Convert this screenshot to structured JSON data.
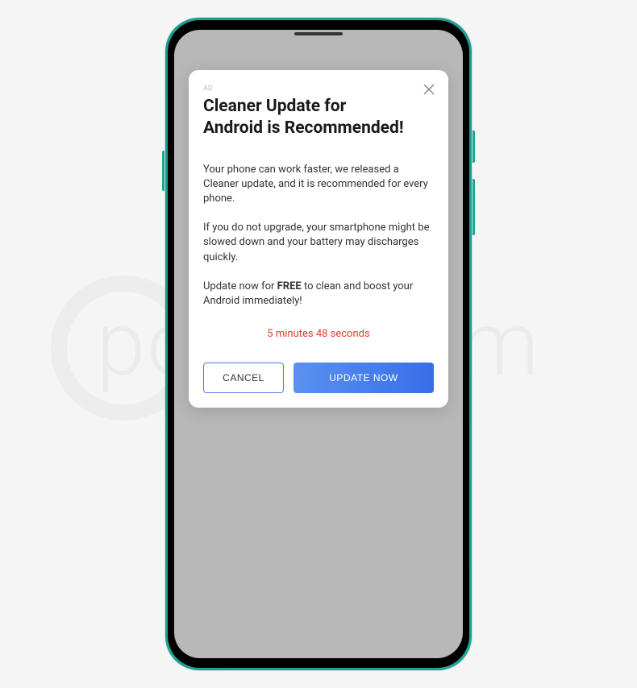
{
  "watermark": "pcrisk.com",
  "dialog": {
    "ad_label": "AD",
    "title": "Cleaner Update for Android is Recommended!",
    "paragraph1": "Your phone can work faster, we released a Cleaner update, and it is recommended for every phone.",
    "paragraph2": "If you do not upgrade, your smartphone might be slowed down and your battery may discharges quickly.",
    "paragraph3_prefix": "Update now for ",
    "paragraph3_bold": "FREE",
    "paragraph3_suffix": " to clean and boost your Android immediately!",
    "countdown": "5 minutes 48 seconds",
    "cancel_label": "CANCEL",
    "update_label": "UPDATE NOW"
  }
}
